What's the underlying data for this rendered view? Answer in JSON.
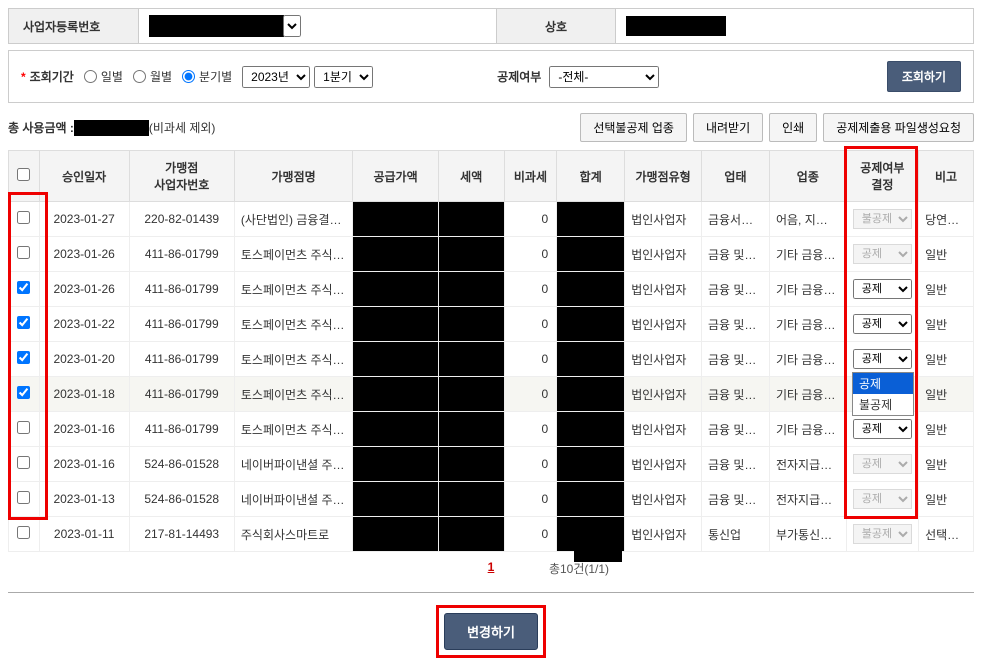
{
  "top": {
    "biz_no_label": "사업자등록번호",
    "company_label": "상호"
  },
  "filter": {
    "period_label": "조회기간",
    "radio_daily": "일별",
    "radio_monthly": "월별",
    "radio_quarterly": "분기별",
    "year_options": [
      "2023년"
    ],
    "year_selected": "2023년",
    "quarter_options": [
      "1분기"
    ],
    "quarter_selected": "1분기",
    "deduct_filter_label": "공제여부",
    "deduct_filter_options": [
      "-전체-"
    ],
    "deduct_filter_selected": "-전체-",
    "search_btn": "조회하기"
  },
  "summary": {
    "total_label": "총 사용금액 :",
    "excl_note": "(비과세 제외)"
  },
  "actions": {
    "btn_exclude": "선택불공제 업종",
    "btn_download": "내려받기",
    "btn_print": "인쇄",
    "btn_filegen": "공제제출용 파일생성요청"
  },
  "table": {
    "headers": {
      "date": "승인일자",
      "bizno": "가맹점\n사업자번호",
      "name": "가맹점명",
      "supply": "공급가액",
      "tax": "세액",
      "notax": "비과세",
      "total": "합계",
      "biztype": "가맹점유형",
      "category": "업태",
      "kind": "업종",
      "deduct": "공제여부\n결정",
      "note": "비고"
    },
    "rows": [
      {
        "chk": false,
        "date": "2023-01-27",
        "bizno": "220-82-01439",
        "name": "(사단법인) 금융결…",
        "notax": "0",
        "biztype": "법인사업자",
        "cat": "금융서비스",
        "kind": "어음, 지…",
        "deduct": "불공제",
        "deduct_disabled": true,
        "note": "당연불…"
      },
      {
        "chk": false,
        "date": "2023-01-26",
        "bizno": "411-86-01799",
        "name": "토스페이먼츠 주식…",
        "notax": "0",
        "biztype": "법인사업자",
        "cat": "금융 및…",
        "kind": "기타 금융…",
        "deduct": "공제",
        "deduct_disabled": true,
        "note": "일반"
      },
      {
        "chk": true,
        "date": "2023-01-26",
        "bizno": "411-86-01799",
        "name": "토스페이먼츠 주식…",
        "notax": "0",
        "biztype": "법인사업자",
        "cat": "금융 및…",
        "kind": "기타 금융…",
        "deduct": "공제",
        "deduct_disabled": false,
        "note": "일반"
      },
      {
        "chk": true,
        "date": "2023-01-22",
        "bizno": "411-86-01799",
        "name": "토스페이먼츠 주식…",
        "notax": "0",
        "biztype": "법인사업자",
        "cat": "금융 및…",
        "kind": "기타 금융…",
        "deduct": "공제",
        "deduct_disabled": false,
        "note": "일반"
      },
      {
        "chk": true,
        "date": "2023-01-20",
        "bizno": "411-86-01799",
        "name": "토스페이먼츠 주식…",
        "notax": "0",
        "biztype": "법인사업자",
        "cat": "금융 및…",
        "kind": "기타 금융…",
        "deduct": "공제",
        "deduct_disabled": false,
        "note": "일반"
      },
      {
        "chk": true,
        "date": "2023-01-18",
        "bizno": "411-86-01799",
        "name": "토스페이먼츠 주식…",
        "notax": "0",
        "biztype": "법인사업자",
        "cat": "금융 및…",
        "kind": "기타 금융…",
        "deduct": "공제",
        "deduct_disabled": false,
        "note": "일반",
        "hl": true,
        "open": true
      },
      {
        "chk": false,
        "date": "2023-01-16",
        "bizno": "411-86-01799",
        "name": "토스페이먼츠 주식…",
        "notax": "0",
        "biztype": "법인사업자",
        "cat": "금융 및…",
        "kind": "기타 금융…",
        "deduct": "공제",
        "deduct_disabled": false,
        "note": "일반"
      },
      {
        "chk": false,
        "date": "2023-01-16",
        "bizno": "524-86-01528",
        "name": "네이버파이낸셜 주…",
        "notax": "0",
        "biztype": "법인사업자",
        "cat": "금융 및…",
        "kind": "전자지급…",
        "deduct": "공제",
        "deduct_disabled": true,
        "note": "일반"
      },
      {
        "chk": false,
        "date": "2023-01-13",
        "bizno": "524-86-01528",
        "name": "네이버파이낸셜 주…",
        "notax": "0",
        "biztype": "법인사업자",
        "cat": "금융 및…",
        "kind": "전자지급…",
        "deduct": "공제",
        "deduct_disabled": true,
        "note": "일반"
      },
      {
        "chk": false,
        "date": "2023-01-11",
        "bizno": "217-81-14493",
        "name": "주식회사스마트로",
        "notax": "0",
        "biztype": "법인사업자",
        "cat": "통신업",
        "kind": "부가통신…",
        "deduct": "불공제",
        "deduct_disabled": true,
        "note": "선택불…"
      }
    ],
    "deduct_options": [
      "공제",
      "불공제"
    ]
  },
  "dropdown_open": {
    "opt1": "공제",
    "opt2": "불공제"
  },
  "pager": {
    "current": "1",
    "count": "총10건(1/1)"
  },
  "submit": {
    "label": "변경하기"
  }
}
